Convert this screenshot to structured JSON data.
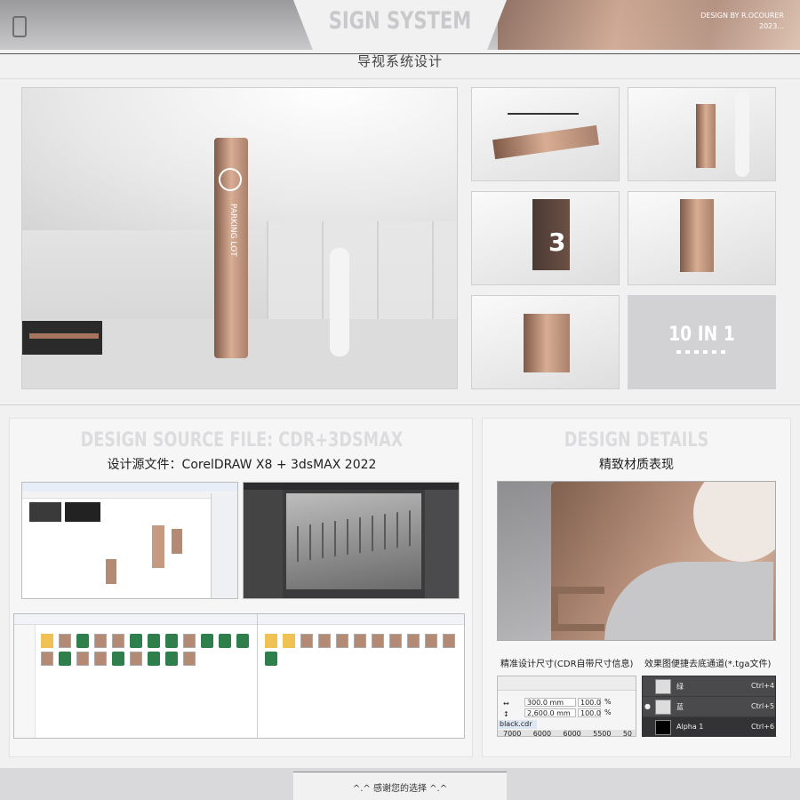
{
  "header": {
    "title_en": "SIGN SYSTEM",
    "title_cn": "导视系统设计",
    "credit_line1": "DESIGN BY R.OCOURER",
    "credit_line2": "2023..."
  },
  "renders": {
    "main_sign_text": "PARKING LOT",
    "badge_text": "10 IN 1",
    "thumb_number": "3"
  },
  "source_section": {
    "title_en": "DESIGN SOURCE FILE: CDR+3DSMAX",
    "title_cn": "设计源文件：CorelDRAW X8  +  3dsMAX 2022"
  },
  "details_section": {
    "title_en": "DESIGN DETAILS",
    "title_cn": "精致材质表现",
    "label_dimensions": "精准设计尺寸(CDR自带尺寸信息)",
    "label_channel": "效果图便捷去底通道(*.tga文件)"
  },
  "dimension_panel": {
    "width_value": "300.0 mm",
    "height_value": "2,600.0 mm",
    "scale_w": "100.0",
    "scale_h": "100.0",
    "pct": "%",
    "file_tab": "black.cdr",
    "ruler": [
      "7000",
      "6000",
      "6000",
      "5500",
      "50"
    ]
  },
  "layers_panel": {
    "rows": [
      {
        "name": "绿",
        "shortcut": "Ctrl+4"
      },
      {
        "name": "蓝",
        "shortcut": "Ctrl+5"
      },
      {
        "name": "Alpha 1",
        "shortcut": "Ctrl+6"
      }
    ]
  },
  "footer": {
    "text": "^.^  感谢您的选择  ^.^"
  },
  "colors": {
    "copper": "#b8917c",
    "background": "#f1f1f2",
    "title_gray": "#c9c9cb"
  }
}
